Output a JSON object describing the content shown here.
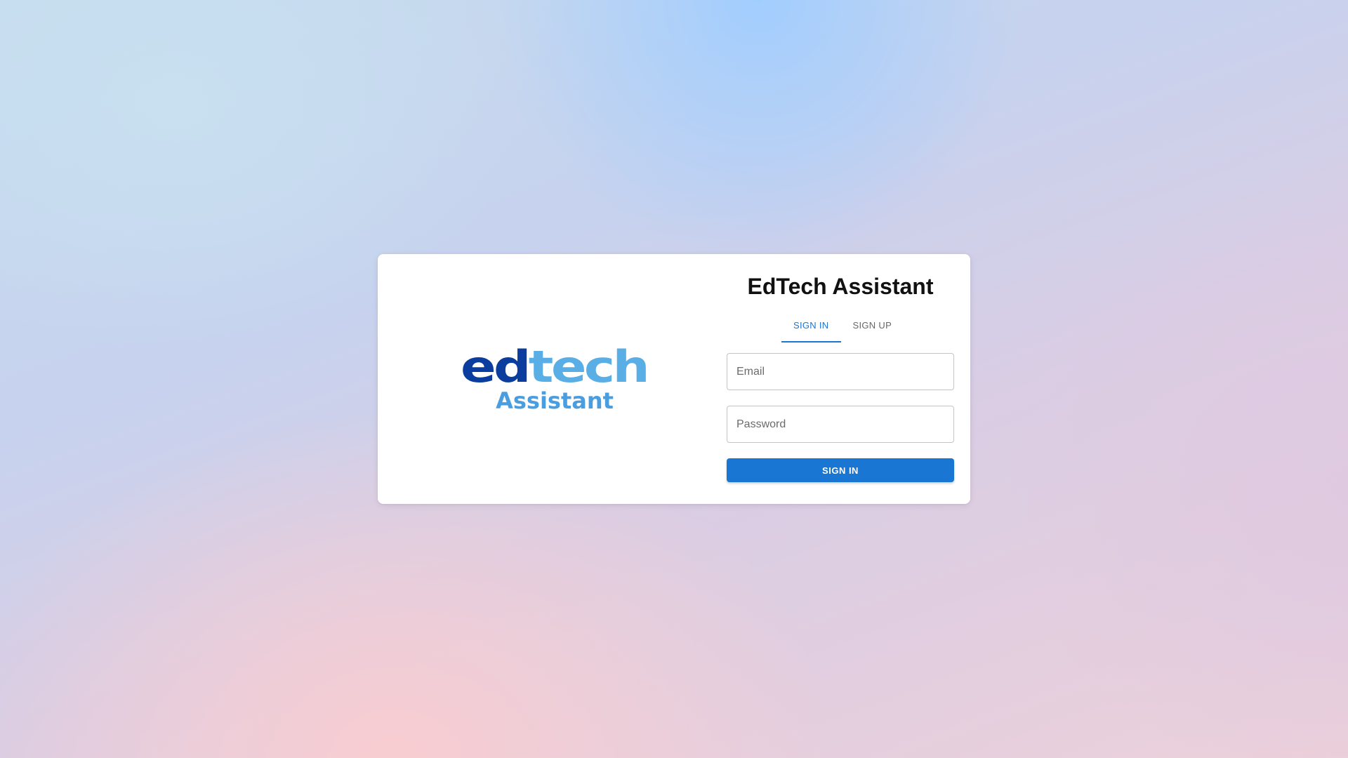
{
  "logo": {
    "word_part1": "ed",
    "word_part2": "tech",
    "subtitle": "Assistant",
    "colors": {
      "dark_blue": "#0a3d9e",
      "light_blue": "#5aaee6"
    }
  },
  "form": {
    "title": "EdTech Assistant",
    "tabs": [
      {
        "label": "SIGN IN",
        "active": true
      },
      {
        "label": "SIGN UP",
        "active": false
      }
    ],
    "email": {
      "placeholder": "Email",
      "value": ""
    },
    "password": {
      "placeholder": "Password",
      "value": ""
    },
    "submit_label": "SIGN IN"
  },
  "colors": {
    "accent": "#1976d2",
    "card_background": "#ffffff"
  }
}
